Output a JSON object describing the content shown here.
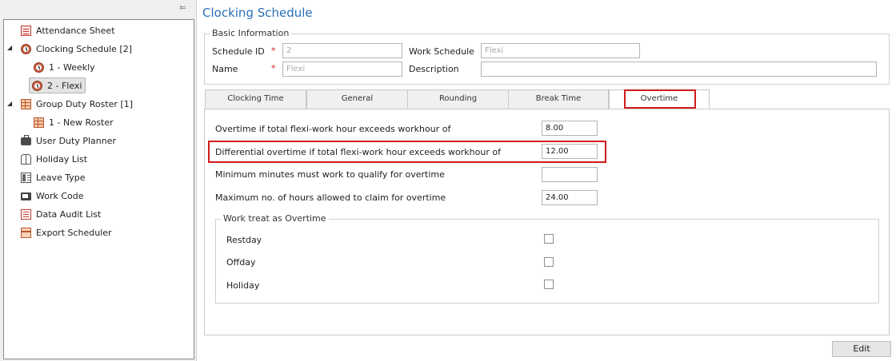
{
  "sidebar": {
    "pin_icon": "pin-icon",
    "items": [
      {
        "label": "Attendance Sheet",
        "icon": "document-icon"
      },
      {
        "label": "Clocking Schedule [2]",
        "icon": "clock-icon",
        "expanded": true
      },
      {
        "label": "1 - Weekly",
        "icon": "clock-icon"
      },
      {
        "label": "2 - Flexi",
        "icon": "clock-icon",
        "selected": true
      },
      {
        "label": "Group Duty Roster [1]",
        "icon": "roster-icon",
        "expanded": true
      },
      {
        "label": "1 - New Roster",
        "icon": "roster-icon"
      },
      {
        "label": "User Duty Planner",
        "icon": "briefcase-icon"
      },
      {
        "label": "Holiday List",
        "icon": "holiday-icon"
      },
      {
        "label": "Leave Type",
        "icon": "leave-icon"
      },
      {
        "label": "Work Code",
        "icon": "code-icon"
      },
      {
        "label": "Data Audit List",
        "icon": "audit-icon"
      },
      {
        "label": "Export Scheduler",
        "icon": "export-icon"
      }
    ]
  },
  "main": {
    "title": "Clocking Schedule",
    "basic_info": {
      "legend": "Basic Information",
      "schedule_id_label": "Schedule ID",
      "schedule_id_value": "2",
      "name_label": "Name",
      "name_value": "Flexi",
      "work_schedule_label": "Work Schedule",
      "work_schedule_value": "Flexi",
      "description_label": "Description",
      "description_value": "",
      "required_mark": "*"
    },
    "tabs": [
      {
        "label": "Clocking Time"
      },
      {
        "label": "General"
      },
      {
        "label": "Rounding"
      },
      {
        "label": "Break Time"
      },
      {
        "label": "Overtime",
        "active": true
      }
    ],
    "overtime": {
      "rows": [
        {
          "label": "Overtime if total flexi-work hour exceeds workhour of",
          "value": "8.00"
        },
        {
          "label": "Differential overtime if total flexi-work hour exceeds workhour of",
          "value": "12.00"
        },
        {
          "label": "Minimum minutes must work to qualify for overtime",
          "value": ""
        },
        {
          "label": "Maximum no. of hours allowed to claim for overtime",
          "value": "24.00"
        }
      ],
      "work_treat": {
        "legend": "Work treat as Overtime",
        "items": [
          {
            "label": "Restday",
            "checked": false
          },
          {
            "label": "Offday",
            "checked": false
          },
          {
            "label": "Holiday",
            "checked": false
          }
        ]
      }
    },
    "edit_label": "Edit"
  },
  "colors": {
    "accent_title": "#2a6fb5",
    "highlight": "#d11a1a",
    "required": "#d21f1f"
  }
}
